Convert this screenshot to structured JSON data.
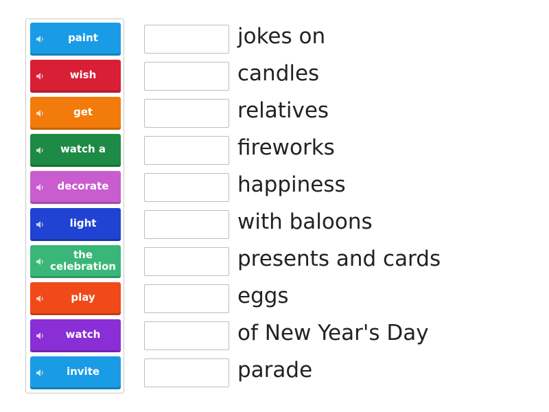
{
  "tiles": [
    {
      "label": "paint",
      "color": "#1a9be6"
    },
    {
      "label": "wish",
      "color": "#d81f36"
    },
    {
      "label": "get",
      "color": "#f27b0c"
    },
    {
      "label": "watch a",
      "color": "#1d8a45"
    },
    {
      "label": "decorate",
      "color": "#c95ccf"
    },
    {
      "label": "light",
      "color": "#2043d3"
    },
    {
      "label": "the celebration",
      "color": "#3ab678"
    },
    {
      "label": "play",
      "color": "#f0491a"
    },
    {
      "label": "watch",
      "color": "#8a2ed6"
    },
    {
      "label": "invite",
      "color": "#1a9be6"
    }
  ],
  "phrases": [
    "jokes on",
    "candles",
    "relatives",
    "fireworks",
    "happiness",
    "with baloons",
    "presents and cards",
    "eggs",
    "of New Year's Day",
    "parade"
  ],
  "speaker_icon": "speaker-icon"
}
